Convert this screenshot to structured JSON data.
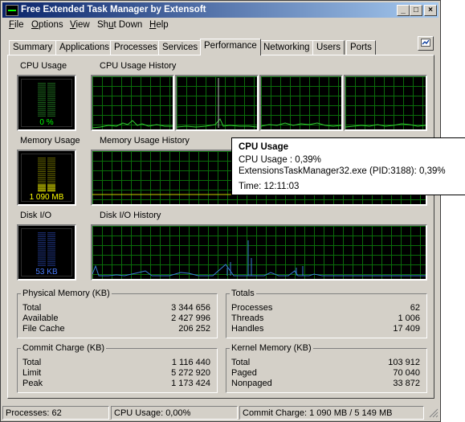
{
  "window": {
    "title": "Free Extended Task Manager by Extensoft",
    "minimize": "_",
    "maximize": "□",
    "close": "×"
  },
  "menu": [
    {
      "pre": "",
      "u": "F",
      "post": "ile"
    },
    {
      "pre": "",
      "u": "O",
      "post": "ptions"
    },
    {
      "pre": "",
      "u": "V",
      "post": "iew"
    },
    {
      "pre": "Sh",
      "u": "u",
      "post": "t Down"
    },
    {
      "pre": "",
      "u": "H",
      "post": "elp"
    }
  ],
  "tabs": [
    "Summary",
    "Applications",
    "Processes",
    "Services",
    "Performance",
    "Networking",
    "Users",
    "Ports"
  ],
  "active_tab": "Performance",
  "gauges": {
    "cpu": {
      "label": "CPU Usage",
      "value": "0 %",
      "level": 0.0,
      "color": "#00ff00"
    },
    "memory": {
      "label": "Memory Usage",
      "value": "1 090 MB",
      "level": 0.21,
      "color": "#ffff00"
    },
    "disk": {
      "label": "Disk I/O",
      "value": "53 KB",
      "level": 0.0,
      "color": "#4a7dff"
    }
  },
  "history": {
    "cpu_label": "CPU Usage History",
    "memory_label": "Memory Usage History",
    "disk_label": "Disk I/O History"
  },
  "physical_memory": {
    "title": "Physical Memory (KB)",
    "rows": [
      {
        "k": "Total",
        "v": "3 344 656"
      },
      {
        "k": "Available",
        "v": "2 427 996"
      },
      {
        "k": "File Cache",
        "v": "206 252"
      }
    ]
  },
  "totals": {
    "title": "Totals",
    "rows": [
      {
        "k": "Processes",
        "v": "62"
      },
      {
        "k": "Threads",
        "v": "1 006"
      },
      {
        "k": "Handles",
        "v": "17 409"
      }
    ]
  },
  "commit_charge": {
    "title": "Commit Charge (KB)",
    "rows": [
      {
        "k": "Total",
        "v": "1 116 440"
      },
      {
        "k": "Limit",
        "v": "5 272 920"
      },
      {
        "k": "Peak",
        "v": "1 173 424"
      }
    ]
  },
  "kernel_memory": {
    "title": "Kernel Memory (KB)",
    "rows": [
      {
        "k": "Total",
        "v": "103 912"
      },
      {
        "k": "Paged",
        "v": "70 040"
      },
      {
        "k": "Nonpaged",
        "v": "33 872"
      }
    ]
  },
  "status": {
    "processes": "Processes: 62",
    "cpu": "CPU Usage: 0,00%",
    "commit": "Commit Charge: 1 090 MB / 5 149 MB"
  },
  "tooltip": {
    "title": "CPU Usage",
    "line1": "CPU Usage : 0,39%",
    "line2": "ExtensionsTaskManager32.exe (PID:3188): 0,39%",
    "line3": "Time: 12:11:03"
  },
  "colors": {
    "cpu_line": "#33cc33",
    "mem_line": "#cccc00",
    "disk_line": "#3a7bd5",
    "grid": "#0a6d0a"
  }
}
